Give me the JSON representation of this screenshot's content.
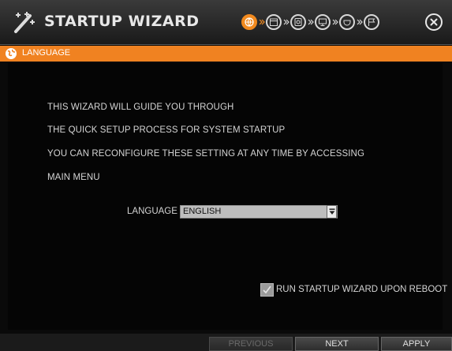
{
  "window": {
    "title": "STARTUP WIZARD",
    "steps": [
      {
        "icon": "globe-icon",
        "active": true
      },
      {
        "icon": "calendar-icon",
        "active": false
      },
      {
        "icon": "disk-icon",
        "active": false
      },
      {
        "icon": "monitor-icon",
        "active": false
      },
      {
        "icon": "camera-icon",
        "active": false
      },
      {
        "icon": "finish-flag-icon",
        "active": false
      }
    ]
  },
  "section": {
    "label": "LANGUAGE",
    "icon": "globe-icon"
  },
  "content": {
    "lines": [
      "THIS WIZARD WILL GUIDE YOU THROUGH",
      "THE  QUICK SETUP PROCESS FOR SYSTEM STARTUP",
      "YOU CAN RECONFIGURE THESE SETTING AT ANY TIME BY ACCESSING",
      "MAIN MENU"
    ],
    "language_label": "LANGUAGE",
    "language_value": "ENGLISH",
    "checkbox_label": "RUN STARTUP WIZARD UPON REBOOT",
    "checkbox_checked": true
  },
  "buttons": {
    "previous": "PREVIOUS",
    "next": "NEXT",
    "apply": "APPLY"
  },
  "colors": {
    "accent": "#f08221",
    "background": "#050505"
  }
}
